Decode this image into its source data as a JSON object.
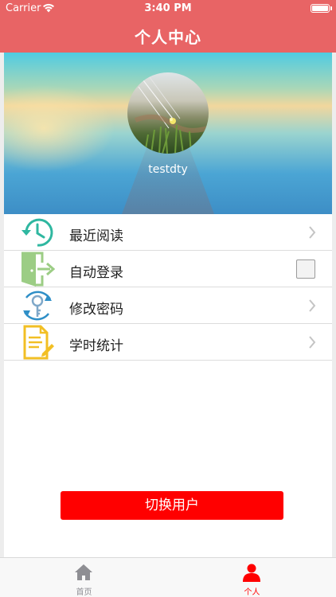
{
  "status_bar": {
    "carrier": "Carrier",
    "time": "3:40 PM"
  },
  "nav": {
    "title": "个人中心"
  },
  "profile": {
    "username": "testdty"
  },
  "menu": {
    "items": [
      {
        "label": "最近阅读",
        "icon": "history-clock-icon",
        "accessory": "chevron"
      },
      {
        "label": "自动登录",
        "icon": "exit-door-icon",
        "accessory": "checkbox",
        "checked": false
      },
      {
        "label": "修改密码",
        "icon": "key-refresh-icon",
        "accessory": "chevron"
      },
      {
        "label": "学时统计",
        "icon": "document-edit-icon",
        "accessory": "chevron"
      }
    ]
  },
  "actions": {
    "switch_user_label": "切换用户"
  },
  "tab_bar": {
    "tabs": [
      {
        "label": "首页",
        "icon": "home-icon",
        "selected": false
      },
      {
        "label": "个人",
        "icon": "person-icon",
        "selected": true
      }
    ]
  },
  "colors": {
    "header": "#e86465",
    "accent": "#ff0000",
    "teal_icon": "#2fb7a0",
    "green_icon": "#8ec07c",
    "blue_icon": "#2f8fc7",
    "yellow_icon": "#f2bf24",
    "tab_inactive": "#8e8e93"
  }
}
